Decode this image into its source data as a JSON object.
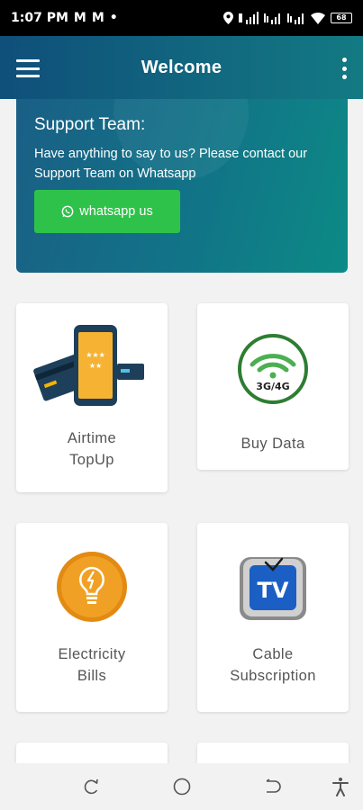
{
  "status_bar": {
    "time": "1:07 PM",
    "indicators": [
      "M",
      "M",
      "•"
    ],
    "battery": "68"
  },
  "app_bar": {
    "title": "Welcome",
    "menu_icon": "hamburger-menu-icon",
    "more_icon": "more-vertical-icon"
  },
  "support": {
    "title": "Support Team:",
    "text": "Have anything to say to us? Please contact our Support Team on Whatsapp",
    "button_label": "whatsapp us",
    "button_color": "#2fc24a"
  },
  "services": [
    {
      "label": "Airtime\nTopUp",
      "icon": "airtime-phone-icon"
    },
    {
      "label": "Buy Data",
      "icon": "3g-4g-wifi-icon",
      "icon_text": "3G/4G"
    },
    {
      "label": "Electricity\nBills",
      "icon": "lightbulb-icon"
    },
    {
      "label": "Cable\nSubscription",
      "icon": "tv-icon",
      "icon_text": "TV"
    }
  ],
  "colors": {
    "app_bar_start": "#0f4f7a",
    "app_bar_end": "#137a83",
    "accent_green": "#2fc24a"
  }
}
